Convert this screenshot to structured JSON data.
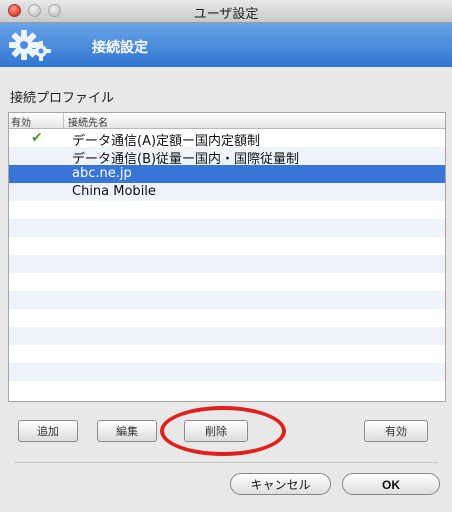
{
  "window": {
    "title": "ユーザ設定"
  },
  "header": {
    "title": "接続設定",
    "icon": "gear-icon"
  },
  "section": {
    "label": "接続プロファイル"
  },
  "table": {
    "columns": [
      "有効",
      "接続先名"
    ],
    "rows": [
      {
        "enabled": true,
        "name": "データ通信(A)定額ー国内定額制"
      },
      {
        "enabled": false,
        "name": "データ通信(B)従量ー国内・国際従量制"
      },
      {
        "enabled": false,
        "name": "abc.ne.jp",
        "selected": true
      },
      {
        "enabled": false,
        "name": "China Mobile"
      }
    ]
  },
  "buttons": {
    "add": "追加",
    "edit": "編集",
    "delete": "削除",
    "enable": "有効",
    "cancel": "キャンセル",
    "ok": "OK"
  },
  "colors": {
    "accent": "#3875d7",
    "header_blue": "#2f75d0",
    "highlight_red": "#e0201a",
    "check_green": "#4f9a2e"
  }
}
